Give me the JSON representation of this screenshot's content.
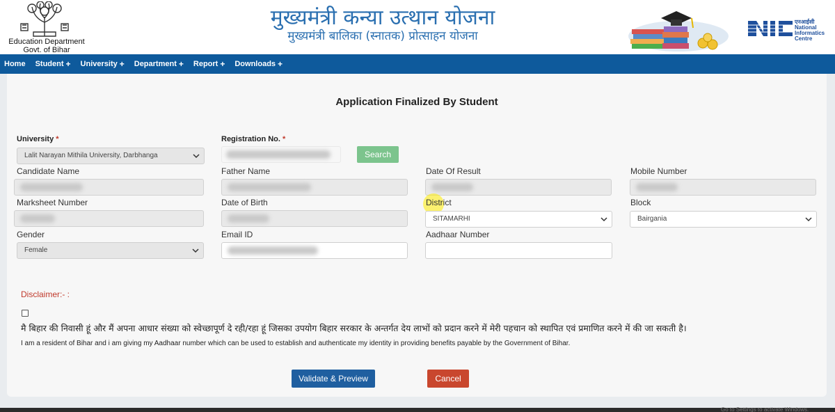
{
  "header": {
    "dept_line1": "Education Department",
    "dept_line2": "Govt. of Bihar",
    "scheme_title": "मुख्यमंत्री कन्या उत्थान योजना",
    "scheme_subtitle": "मुख्यमंत्री बालिका (स्नातक) प्रोत्साहन योजना",
    "nic_hindi": "एनआईसी",
    "nic_line1": "National",
    "nic_line2": "Informatics",
    "nic_line3": "Centre"
  },
  "nav": {
    "items": [
      {
        "label": "Home",
        "has_plus": false
      },
      {
        "label": "Student",
        "has_plus": true
      },
      {
        "label": "University",
        "has_plus": true
      },
      {
        "label": "Department",
        "has_plus": true
      },
      {
        "label": "Report",
        "has_plus": true
      },
      {
        "label": "Downloads",
        "has_plus": true
      }
    ],
    "plus": "+"
  },
  "form": {
    "title": "Application Finalized By Student",
    "required_mark": "*",
    "university_label": "University",
    "university_value": "Lalit Narayan Mithila University, Darbhanga",
    "registration_label": "Registration No.",
    "search_label": "Search",
    "candidate_name_label": "Candidate Name",
    "father_name_label": "Father Name",
    "date_of_result_label": "Date Of Result",
    "mobile_label": "Mobile Number",
    "marksheet_label": "Marksheet Number",
    "dob_label": "Date of Birth",
    "district_label": "District",
    "district_value": "SITAMARHI",
    "block_label": "Block",
    "block_value": "Bairgania",
    "gender_label": "Gender",
    "gender_value": "Female",
    "email_label": "Email ID",
    "aadhaar_label": "Aadhaar Number"
  },
  "disclaimer": {
    "heading": "Disclaimer:- :",
    "hindi": "मै बिहार की निवासी हूं और मैं अपना आधार संख्या को स्वेच्छापूर्ण दे रही/रहा हूं जिसका उपयोग बिहार सरकार के अन्तर्गत देय लाभों को प्रदान करने में मेरी पहचान को स्थापित एवं प्रमाणित करने में की जा सकती है।",
    "english": "I am a resident of Bihar and i am giving my Aadhaar number which can be used to establish and authenticate my identity in providing benefits payable by the Government of Bihar."
  },
  "actions": {
    "validate_label": "Validate & Preview",
    "cancel_label": "Cancel"
  },
  "system": {
    "activate_text": "Go to Settings to activate Windows."
  },
  "colors": {
    "navbar": "#0e5a9c",
    "title_blue": "#2a6fb0",
    "search_green": "#7cc48d",
    "validate_blue": "#1f5fa0",
    "cancel_red": "#c9472e",
    "disclaimer_red": "#c0392b"
  }
}
